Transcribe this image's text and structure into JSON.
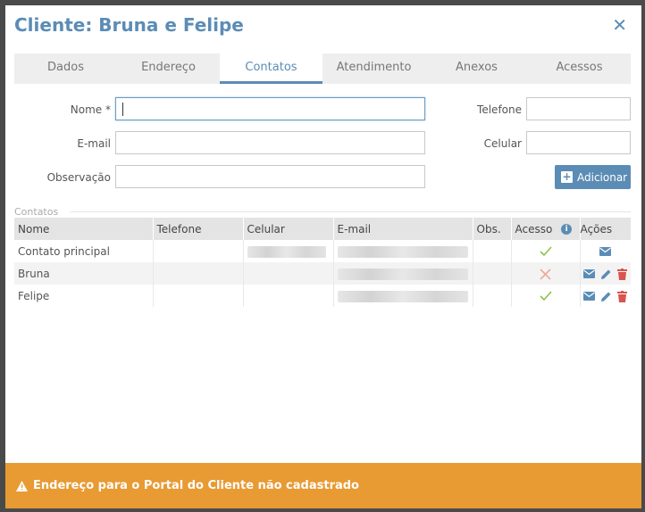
{
  "modal": {
    "title": "Cliente: Bruna e Felipe",
    "close_glyph": "✕"
  },
  "tabs": [
    {
      "label": "Dados"
    },
    {
      "label": "Endereço"
    },
    {
      "label": "Contatos"
    },
    {
      "label": "Atendimento"
    },
    {
      "label": "Anexos"
    },
    {
      "label": "Acessos"
    }
  ],
  "active_tab": "Contatos",
  "form": {
    "nome_label": "Nome *",
    "nome_value": "",
    "email_label": "E-mail",
    "email_value": "",
    "observacao_label": "Observação",
    "observacao_value": "",
    "telefone_label": "Telefone",
    "telefone_value": "",
    "celular_label": "Celular",
    "celular_value": "",
    "add_button": "Adicionar"
  },
  "contacts": {
    "section_label": "Contatos",
    "columns": [
      "Nome",
      "Telefone",
      "Celular",
      "E-mail",
      "Obs.",
      "Acesso",
      "Ações"
    ],
    "info_glyph": "i",
    "rows": [
      {
        "nome": "Contato principal",
        "acesso": "yes",
        "actions": [
          "email"
        ]
      },
      {
        "nome": "Bruna",
        "acesso": "no",
        "actions": [
          "email",
          "edit",
          "delete"
        ]
      },
      {
        "nome": "Felipe",
        "acesso": "yes",
        "actions": [
          "email",
          "edit",
          "delete"
        ]
      }
    ]
  },
  "footer": {
    "message": "Endereço para o Portal do Cliente não cadastrado"
  },
  "colors": {
    "accent": "#5b8cb5",
    "warning": "#e89a33",
    "check": "#8bc34a",
    "cross": "#f0a89a",
    "delete": "#d9534f"
  }
}
